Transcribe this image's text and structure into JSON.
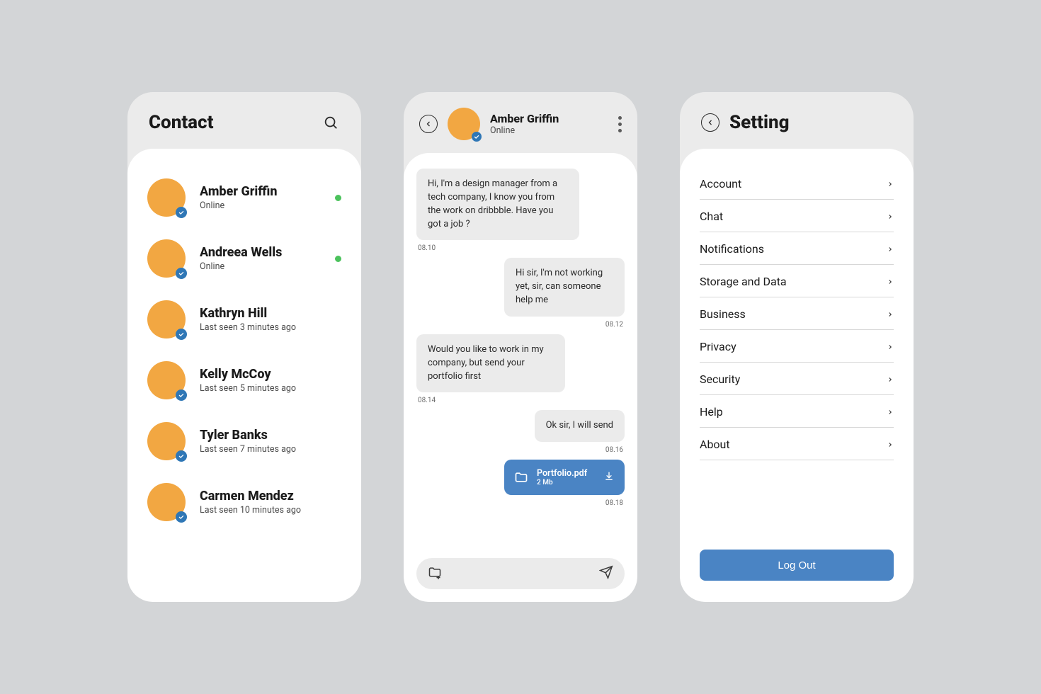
{
  "colors": {
    "bg": "#d3d5d7",
    "panel": "#ebebeb",
    "avatar": "#f2a742",
    "badge": "#2f77b6",
    "online": "#4bc25c",
    "accent": "#4a84c4"
  },
  "contacts": {
    "title": "Contact",
    "items": [
      {
        "name": "Amber Griffin",
        "status": "Online",
        "online": true
      },
      {
        "name": "Andreea Wells",
        "status": "Online",
        "online": true
      },
      {
        "name": "Kathryn Hill",
        "status": "Last seen 3 minutes ago",
        "online": false
      },
      {
        "name": "Kelly McCoy",
        "status": "Last seen 5 minutes ago",
        "online": false
      },
      {
        "name": "Tyler Banks",
        "status": "Last seen 7 minutes ago",
        "online": false
      },
      {
        "name": "Carmen Mendez",
        "status": "Last seen 10 minutes ago",
        "online": false
      }
    ]
  },
  "chat": {
    "name": "Amber Griffin",
    "status": "Online",
    "messages": [
      {
        "side": "left",
        "text": "Hi, I'm a design manager from a tech company, I know you from the work on dribbble. Have you got a job ?",
        "time": "08.10"
      },
      {
        "side": "right",
        "text": "Hi sir, I'm not working yet, sir, can someone help me",
        "time": "08.12"
      },
      {
        "side": "left",
        "text": "Would you like to work in my company, but send your portfolio first",
        "time": "08.14"
      },
      {
        "side": "right",
        "text": "Ok sir, I will send",
        "time": "08.16"
      }
    ],
    "attachment": {
      "name": "Portfolio.pdf",
      "size": "2 Mb",
      "time": "08.18"
    }
  },
  "settings": {
    "title": "Setting",
    "items": [
      {
        "label": "Account"
      },
      {
        "label": "Chat"
      },
      {
        "label": "Notifications"
      },
      {
        "label": "Storage and Data"
      },
      {
        "label": "Business"
      },
      {
        "label": "Privacy"
      },
      {
        "label": "Security"
      },
      {
        "label": "Help"
      },
      {
        "label": "About"
      }
    ],
    "logout_label": "Log Out"
  }
}
